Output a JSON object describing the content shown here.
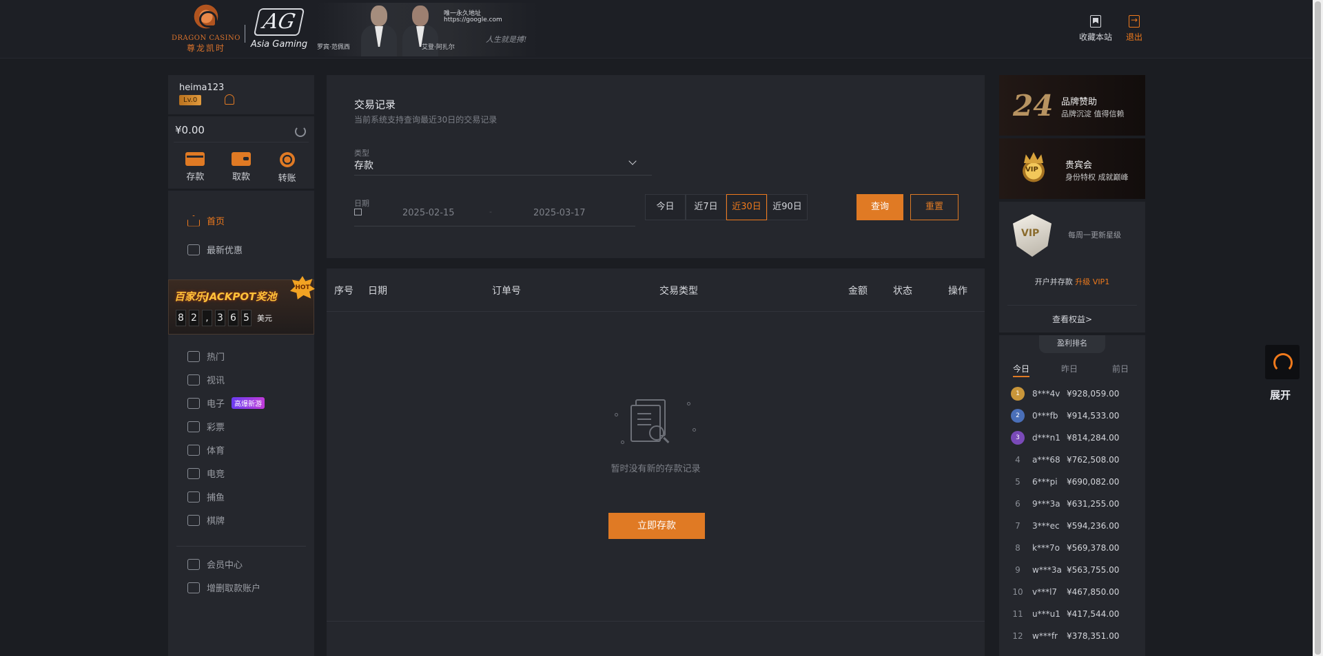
{
  "header": {
    "brand_en": "DRAGON CASINO",
    "brand_cn": "尊龙凯时",
    "ag_logo": "AG",
    "ag_text": "Asia Gaming",
    "banner_url_title": "唯一永久地址",
    "banner_url": "https://google.com",
    "banner_name_1": "罗宾·范佩西",
    "banner_name_2": "艾登·阿扎尔",
    "banner_slogan": "人生就是搏!",
    "bookmark_label": "收藏本站",
    "logout_label": "退出"
  },
  "user": {
    "name": "heima123",
    "level": "Lv.0",
    "balance": "¥0.00",
    "actions": [
      {
        "label": "存款",
        "icon": "card-icon"
      },
      {
        "label": "取款",
        "icon": "wallet-icon"
      },
      {
        "label": "转账",
        "icon": "chip-icon"
      }
    ]
  },
  "nav": {
    "home": "首页",
    "promotions": "最新优惠",
    "jackpot_title": "百家乐JACKPOT奖池",
    "jackpot_badge": "HOT",
    "jackpot_digits": [
      "8",
      "2",
      ",",
      "3",
      "6",
      "5"
    ],
    "jackpot_unit": "美元",
    "hot": "热门",
    "live": "视讯",
    "slots": "电子",
    "slots_tag": "高爆新游",
    "lottery": "彩票",
    "sports": "体育",
    "esports": "电竞",
    "fishing": "捕鱼",
    "cards": "棋牌",
    "member_center": "会员中心",
    "add_account": "增删取款账户"
  },
  "filter": {
    "title": "交易记录",
    "subtitle": "当前系统支持查询最近30日的交易记录",
    "type_label": "类型",
    "type_value": "存款",
    "date_label": "日期",
    "date_from": "2025-02-15",
    "date_sep": "-",
    "date_to": "2025-03-17",
    "ranges": [
      "今日",
      "近7日",
      "近30日",
      "近90日"
    ],
    "selected_range": "近30日",
    "query": "查询",
    "reset": "重置"
  },
  "table": {
    "columns": [
      "序号",
      "日期",
      "订单号",
      "交易类型",
      "金额",
      "状态",
      "操作"
    ],
    "rows": [],
    "empty_text": "暂时没有新的存款记录",
    "deposit_button": "立即存款"
  },
  "right": {
    "promo1_number": "24",
    "promo1_title": "品牌赞助",
    "promo1_sub": "品牌沉淀 值得信赖",
    "promo2_title": "贵宾会",
    "promo2_sub": "身份特权 成就巅峰",
    "vip_week": "每周一更新星级",
    "vip_open_prefix": "开户并存款",
    "vip_open_highlight": "升级 VIP1",
    "vip_more": "查看权益>",
    "rank_title": "盈利排名",
    "rank_tabs": [
      "今日",
      "昨日",
      "前日"
    ],
    "ranking": [
      {
        "rank": "1",
        "user": "8***4v",
        "amount": "¥928,059.00"
      },
      {
        "rank": "2",
        "user": "0***fb",
        "amount": "¥914,533.00"
      },
      {
        "rank": "3",
        "user": "d***n1",
        "amount": "¥814,284.00"
      },
      {
        "rank": "4",
        "user": "a***68",
        "amount": "¥762,508.00"
      },
      {
        "rank": "5",
        "user": "6***pi",
        "amount": "¥690,082.00"
      },
      {
        "rank": "6",
        "user": "9***3a",
        "amount": "¥631,255.00"
      },
      {
        "rank": "7",
        "user": "3***ec",
        "amount": "¥594,236.00"
      },
      {
        "rank": "8",
        "user": "k***7o",
        "amount": "¥569,378.00"
      },
      {
        "rank": "9",
        "user": "w***3a",
        "amount": "¥563,755.00"
      },
      {
        "rank": "10",
        "user": "v***l7",
        "amount": "¥467,850.00"
      },
      {
        "rank": "11",
        "user": "u***u1",
        "amount": "¥417,544.00"
      },
      {
        "rank": "12",
        "user": "w***fr",
        "amount": "¥378,351.00"
      }
    ]
  },
  "float": {
    "label": "展开"
  },
  "colors": {
    "accent": "#e07a24",
    "bg": "#1b1d22",
    "panel": "#25272d"
  }
}
